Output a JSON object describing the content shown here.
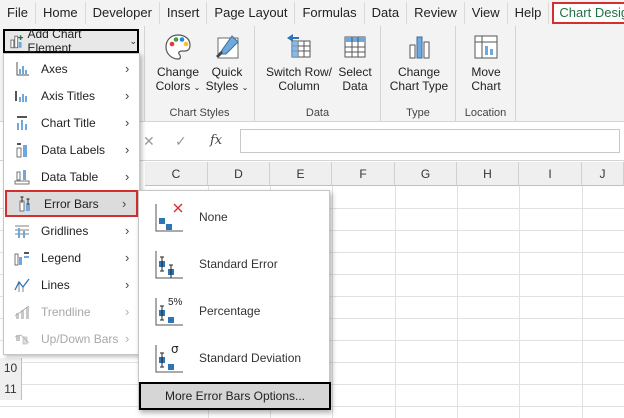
{
  "tabs": [
    "File",
    "Home",
    "Developer",
    "Insert",
    "Page Layout",
    "Formulas",
    "Data",
    "Review",
    "View",
    "Help"
  ],
  "active_tab": "Chart Design",
  "ribbon": {
    "add_chart_element": "Add Chart Element",
    "change_colors": [
      "Change",
      "Colors"
    ],
    "quick_styles": [
      "Quick",
      "Styles"
    ],
    "chart_styles_label": "Chart Styles",
    "switch_row_column": [
      "Switch Row/",
      "Column"
    ],
    "select_data": [
      "Select",
      "Data"
    ],
    "data_label": "Data",
    "change_chart_type": [
      "Change",
      "Chart Type"
    ],
    "type_label": "Type",
    "move_chart": [
      "Move",
      "Chart"
    ],
    "location_label": "Location"
  },
  "formula_bar": {
    "cancel": "✕",
    "enter": "✓",
    "fx": "fx"
  },
  "columns": [
    "C",
    "D",
    "E",
    "F",
    "G",
    "H",
    "I",
    "J"
  ],
  "rows": [
    "10",
    "11"
  ],
  "menu": {
    "items": [
      {
        "label": "Axes",
        "icon": "axes-icon",
        "disabled": false
      },
      {
        "label": "Axis Titles",
        "icon": "axis-titles-icon",
        "disabled": false
      },
      {
        "label": "Chart Title",
        "icon": "chart-title-icon",
        "disabled": false
      },
      {
        "label": "Data Labels",
        "icon": "data-labels-icon",
        "disabled": false
      },
      {
        "label": "Data Table",
        "icon": "data-table-icon",
        "disabled": false
      },
      {
        "label": "Error Bars",
        "icon": "error-bars-icon",
        "disabled": false,
        "selected": true
      },
      {
        "label": "Gridlines",
        "icon": "gridlines-icon",
        "disabled": false
      },
      {
        "label": "Legend",
        "icon": "legend-icon",
        "disabled": false
      },
      {
        "label": "Lines",
        "icon": "lines-icon",
        "disabled": false
      },
      {
        "label": "Trendline",
        "icon": "trendline-icon",
        "disabled": true
      },
      {
        "label": "Up/Down Bars",
        "icon": "up-down-bars-icon",
        "disabled": true
      }
    ]
  },
  "submenu": {
    "items": [
      {
        "label": "None",
        "icon": "error-bars-none-icon"
      },
      {
        "label": "Standard Error",
        "icon": "error-bars-standard-error-icon"
      },
      {
        "label": "Percentage",
        "icon": "error-bars-percentage-icon",
        "badge": "5%"
      },
      {
        "label": "Standard Deviation",
        "icon": "error-bars-standard-deviation-icon",
        "badge": "σ"
      }
    ],
    "more_options": "More Error Bars Options..."
  },
  "colors": {
    "accent_green": "#1e7145",
    "highlight_red": "#d32f2f",
    "outline_black": "#000000"
  }
}
